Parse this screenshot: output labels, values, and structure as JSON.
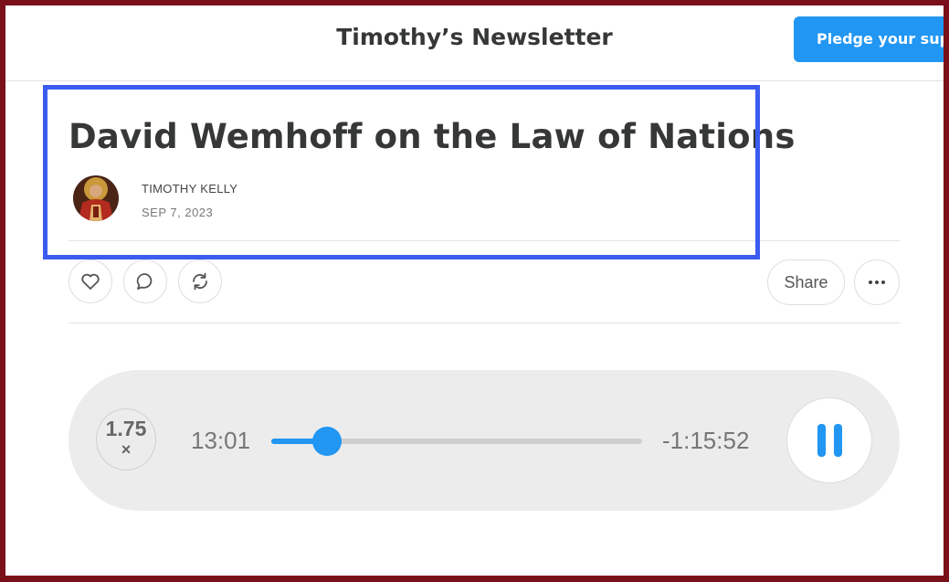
{
  "header": {
    "newsletter_title": "Timothy’s Newsletter",
    "pledge_label": "Pledge your support"
  },
  "post": {
    "title": "David Wemhoff on the Law of Nations",
    "author": "TIMOTHY KELLY",
    "date": "SEP 7, 2023"
  },
  "actions": {
    "share_label": "Share",
    "icons": [
      "heart-icon",
      "comment-icon",
      "restack-icon",
      "more-icon"
    ]
  },
  "player": {
    "speed": "1.75",
    "speed_suffix": "×",
    "elapsed": "13:01",
    "remaining": "-1:15:52",
    "progress_fraction": 0.15,
    "state": "playing"
  },
  "colors": {
    "accent": "#2196f3",
    "frame": "#7a1019",
    "highlight": "#3c5cf0"
  }
}
